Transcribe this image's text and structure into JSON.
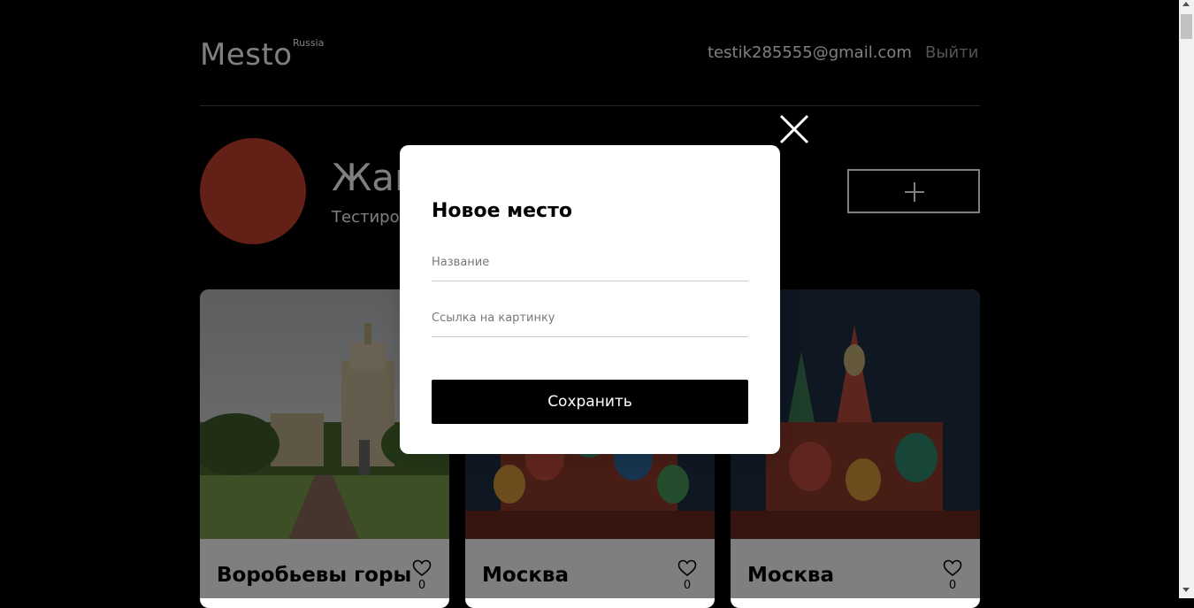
{
  "header": {
    "logo": "Mesto",
    "logo_sup": "Russia",
    "email": "testik285555@gmail.com",
    "logout": "Выйти"
  },
  "profile": {
    "name": "Жак",
    "about": "Тестиров",
    "avatar_color": "#c4402f",
    "add_icon": "plus-icon"
  },
  "cards": [
    {
      "title": "Воробьевы горы",
      "likes": "0",
      "like_icon": "heart-icon"
    },
    {
      "title": "Москва",
      "likes": "0",
      "like_icon": "heart-icon"
    },
    {
      "title": "Москва",
      "likes": "0",
      "like_icon": "heart-icon"
    }
  ],
  "popup": {
    "title": "Новое место",
    "name_placeholder": "Название",
    "link_placeholder": "Ссылка на картинку",
    "save_label": "Сохранить",
    "close_icon": "close-icon"
  }
}
